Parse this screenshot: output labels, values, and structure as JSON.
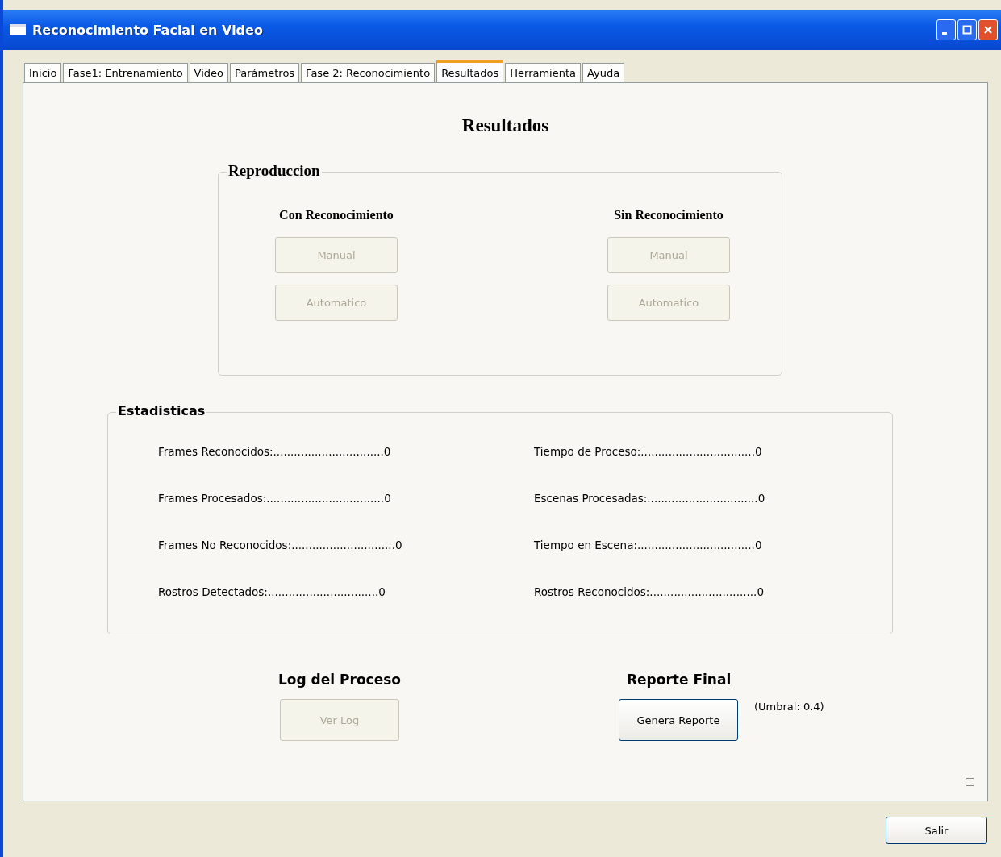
{
  "window": {
    "title": "Reconocimiento Facial en Video"
  },
  "tabs": [
    {
      "label": "Inicio",
      "selected": false
    },
    {
      "label": "Fase1: Entrenamiento",
      "selected": false
    },
    {
      "label": "Video",
      "selected": false
    },
    {
      "label": "Parámetros",
      "selected": false
    },
    {
      "label": "Fase 2: Reconocimiento",
      "selected": false
    },
    {
      "label": "Resultados",
      "selected": true
    },
    {
      "label": "Herramienta",
      "selected": false
    },
    {
      "label": "Ayuda",
      "selected": false
    }
  ],
  "heading": "Resultados",
  "reproduccion": {
    "title": "Reproduccion",
    "columns": [
      {
        "title": "Con Reconocimiento",
        "buttons": [
          {
            "label": "Manual",
            "disabled": true
          },
          {
            "label": "Automatico",
            "disabled": true
          }
        ]
      },
      {
        "title": "Sin Reconocimiento",
        "buttons": [
          {
            "label": "Manual",
            "disabled": true
          },
          {
            "label": "Automatico",
            "disabled": true
          }
        ]
      }
    ]
  },
  "estadisticas": {
    "title": "Estadisticas",
    "columns": [
      [
        "Frames Reconocidos:................................0",
        "Frames Procesados:..................................0",
        "Frames No Reconocidos:..............................0",
        "Rostros Detectados:................................0"
      ],
      [
        "Tiempo de Proceso:.................................0",
        "Escenas Procesadas:................................0",
        "Tiempo en Escena:..................................0",
        "Rostros Reconocidos:...............................0"
      ]
    ]
  },
  "log": {
    "title": "Log del Proceso",
    "button": {
      "label": "Ver Log",
      "disabled": true
    }
  },
  "reporte": {
    "title": "Reporte Final",
    "button": {
      "label": "Genera Reporte",
      "disabled": false
    },
    "note": "(Umbral: 0.4)"
  },
  "footer_button": {
    "label": "Salir",
    "disabled": false
  }
}
